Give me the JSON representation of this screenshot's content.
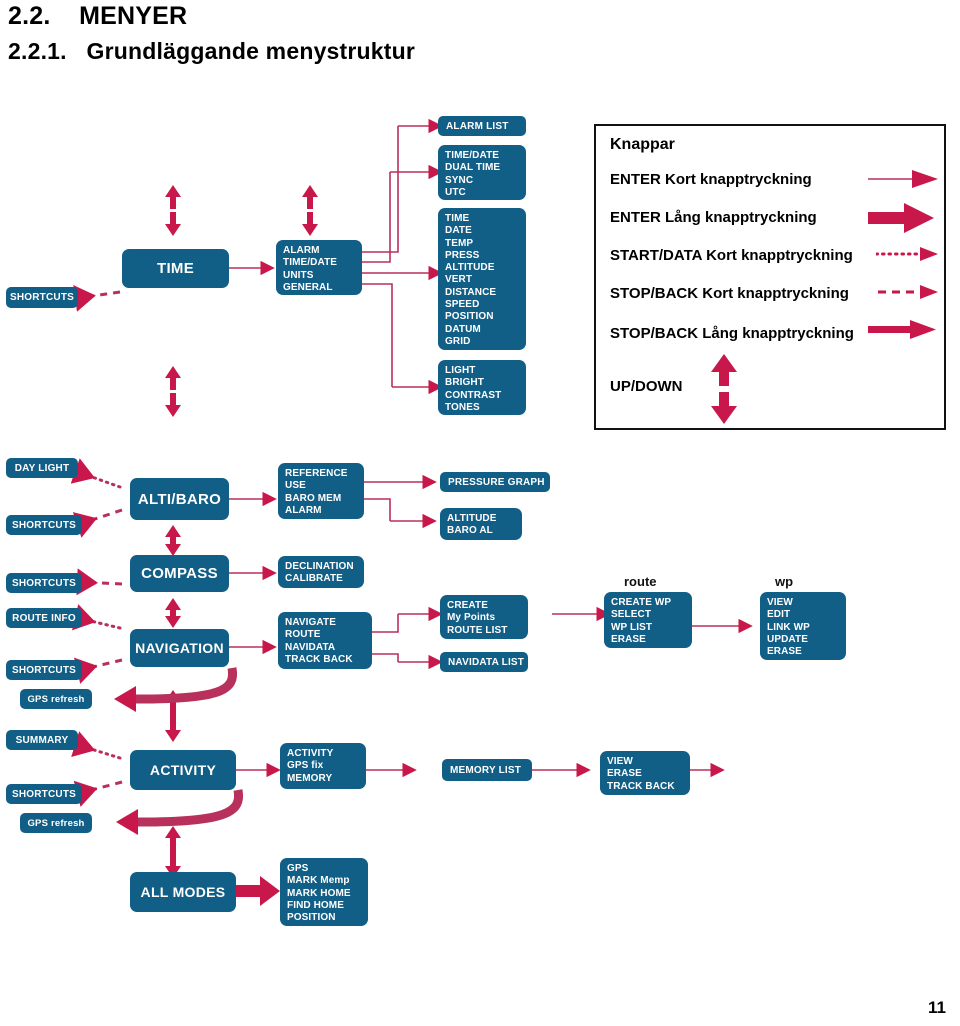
{
  "headings": {
    "section_number": "2.2.",
    "section_title": "MENYER",
    "sub_number": "2.2.1.",
    "sub_title": "Grundläggande menystruktur"
  },
  "page_number": "11",
  "colors": {
    "box_blue": "#115e86",
    "arrow_crimson": "#c8174a",
    "line_crimson": "#b8305c",
    "text_black": "#000000"
  },
  "legend": {
    "title": "Knappar",
    "rows": [
      {
        "label": "ENTER Kort knapptryckning",
        "arrow": "thin-solid-arrow"
      },
      {
        "label": "ENTER Lång knapptryckning",
        "arrow": "thick-solid-arrow"
      },
      {
        "label": "START/DATA Kort knapptryckning",
        "arrow": "dotted-arrow"
      },
      {
        "label": "STOP/BACK Kort knapptryckning",
        "arrow": "dashed-arrow"
      },
      {
        "label": "STOP/BACK Lång knapptryckning",
        "arrow": "bold-solid-arrow"
      },
      {
        "label": "UP/DOWN",
        "arrow": "up-down-arrow"
      }
    ]
  },
  "diagram": {
    "time_section": {
      "shortcuts": "SHORTCUTS",
      "mode": "TIME",
      "menu": [
        "ALARM",
        "TIME/DATE",
        "UNITS",
        "GENERAL"
      ],
      "submenus": [
        {
          "name": "alarm-list",
          "items": [
            "ALARM LIST"
          ]
        },
        {
          "name": "time-date",
          "items": [
            "TIME/DATE",
            "DUAL TIME",
            "SYNC",
            "UTC"
          ]
        },
        {
          "name": "units",
          "items": [
            "TIME",
            "DATE",
            "TEMP",
            "PRESS",
            "ALTITUDE",
            "VERT",
            "DISTANCE",
            "SPEED",
            "POSITION",
            "DATUM",
            "GRID"
          ]
        },
        {
          "name": "general",
          "items": [
            "LIGHT",
            "BRIGHT",
            "CONTRAST",
            "TONES"
          ]
        }
      ]
    },
    "altibaro_section": {
      "day_light": "DAY LIGHT",
      "shortcuts": "SHORTCUTS",
      "mode": "ALTI/BARO",
      "menu": [
        "REFERENCE",
        "USE",
        "BARO MEM",
        "ALARM"
      ],
      "submenus": [
        {
          "name": "pressure-graph",
          "items": [
            "PRESSURE GRAPH"
          ]
        },
        {
          "name": "altitude-baroal",
          "items": [
            "ALTITUDE",
            "BARO AL"
          ]
        }
      ]
    },
    "compass_section": {
      "shortcuts": "SHORTCUTS",
      "mode": "COMPASS",
      "menu": [
        "DECLINATION",
        "CALIBRATE"
      ]
    },
    "navigation_section": {
      "route_info": "ROUTE INFO",
      "shortcuts": "SHORTCUTS",
      "gps_refresh": "GPS refresh",
      "mode": "NAVIGATION",
      "menu": [
        "NAVIGATE",
        "ROUTE",
        "NAVIDATA",
        "TRACK BACK"
      ],
      "submenus": [
        {
          "name": "create-list",
          "items": [
            "CREATE",
            "My Points",
            "ROUTE LIST"
          ]
        },
        {
          "name": "navidata-list",
          "items": [
            "NAVIDATA LIST"
          ]
        }
      ],
      "route_caption": "route",
      "route_items": [
        "CREATE WP",
        "SELECT",
        "WP LIST",
        "ERASE"
      ],
      "wp_caption": "wp",
      "wp_items": [
        "VIEW",
        "EDIT",
        "LINK WP",
        "UPDATE",
        "ERASE"
      ]
    },
    "activity_section": {
      "summary": "SUMMARY",
      "shortcuts": "SHORTCUTS",
      "gps_refresh": "GPS refresh",
      "mode": "ACTIVITY",
      "menu": [
        "ACTIVITY",
        "GPS fix",
        "MEMORY"
      ],
      "memory_list": [
        "MEMORY LIST"
      ],
      "memory_actions": [
        "VIEW",
        "ERASE",
        "TRACK BACK"
      ]
    },
    "allmodes_section": {
      "mode": "ALL MODES",
      "menu": [
        "GPS",
        "MARK Memp",
        "MARK HOME",
        "FIND HOME",
        "POSITION"
      ]
    }
  }
}
